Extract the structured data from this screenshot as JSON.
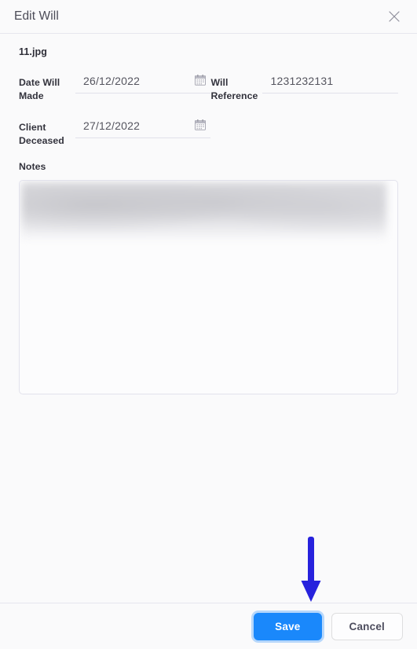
{
  "header": {
    "title": "Edit Will",
    "close_icon": "close-icon"
  },
  "body": {
    "file_name": "11.jpg",
    "fields": [
      {
        "label": "Date Will Made",
        "value": "26/12/2022",
        "placeholder": "DD/MM/YYYY",
        "icon": "calendar-icon"
      },
      {
        "label": "Will Reference",
        "value": "1231232131",
        "placeholder": "",
        "icon": ""
      },
      {
        "label": "Client Deceased",
        "value": "27/12/2022",
        "placeholder": "DD/MM/YYYY",
        "icon": "calendar-icon"
      }
    ],
    "notes": {
      "label": "Notes",
      "value": "",
      "placeholder": "",
      "redacted": true
    }
  },
  "footer": {
    "save_label": "Save",
    "cancel_label": "Cancel"
  },
  "annotation": {
    "type": "arrow-down",
    "points_to": "save-button",
    "color": "#2722dd"
  },
  "colors": {
    "accent": "#1a88fb",
    "annotation": "#2722dd",
    "border": "#e2e2ec",
    "background": "#fafafb",
    "label_text": "#33333d",
    "value_text": "#55555f"
  }
}
